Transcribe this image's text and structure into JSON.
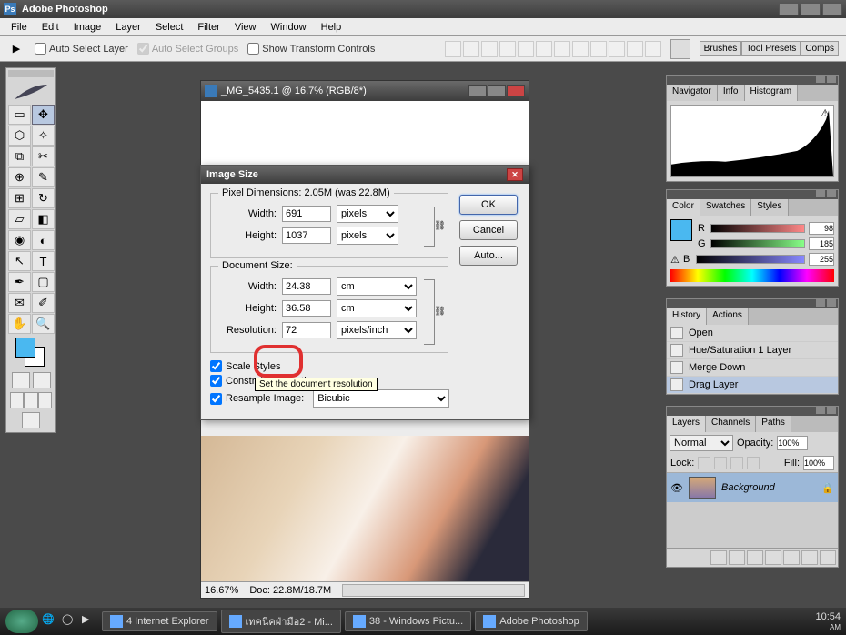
{
  "app": {
    "title": "Adobe Photoshop"
  },
  "menu": [
    "File",
    "Edit",
    "Image",
    "Layer",
    "Select",
    "Filter",
    "View",
    "Window",
    "Help"
  ],
  "options": {
    "auto_select_layer": "Auto Select Layer",
    "auto_select_groups": "Auto Select Groups",
    "show_transform": "Show Transform Controls",
    "tabs": [
      "Brushes",
      "Tool Presets",
      "Comps"
    ]
  },
  "document": {
    "title": "_MG_5435.1 @ 16.7% (RGB/8*)",
    "zoom": "16.67%",
    "doc_size": "Doc: 22.8M/18.7M"
  },
  "dialog": {
    "title": "Image Size",
    "px_legend": "Pixel Dimensions:  2.05M (was 22.8M)",
    "width_lbl": "Width:",
    "height_lbl": "Height:",
    "res_lbl": "Resolution:",
    "px_width": "691",
    "px_height": "1037",
    "px_unit": "pixels",
    "doc_legend": "Document Size:",
    "doc_width": "24.38",
    "doc_height": "36.58",
    "doc_unit": "cm",
    "resolution": "72",
    "res_unit": "pixels/inch",
    "scale_styles": "Scale Styles",
    "constrain": "Constrain Proportions",
    "resample": "Resample Image:",
    "resample_method": "Bicubic",
    "tooltip": "Set the document resolution",
    "ok": "OK",
    "cancel": "Cancel",
    "auto": "Auto..."
  },
  "nav_panel": {
    "tabs": [
      "Navigator",
      "Info",
      "Histogram"
    ]
  },
  "color_panel": {
    "tabs": [
      "Color",
      "Swatches",
      "Styles"
    ],
    "r": "98",
    "g": "185",
    "b": "255"
  },
  "history_panel": {
    "tabs": [
      "History",
      "Actions"
    ],
    "items": [
      "Open",
      "Hue/Saturation 1 Layer",
      "Merge Down",
      "Drag Layer"
    ]
  },
  "layers_panel": {
    "tabs": [
      "Layers",
      "Channels",
      "Paths"
    ],
    "blend": "Normal",
    "opacity_lbl": "Opacity:",
    "opacity": "100%",
    "lock_lbl": "Lock:",
    "fill_lbl": "Fill:",
    "fill": "100%",
    "layer_name": "Background"
  },
  "taskbar": {
    "tasks": [
      "4 Internet Explorer",
      "เทคนิคฝ่ามือ2 - Mi...",
      "38 - Windows Pictu...",
      "Adobe Photoshop"
    ],
    "time": "10:54",
    "ampm": "AM"
  }
}
